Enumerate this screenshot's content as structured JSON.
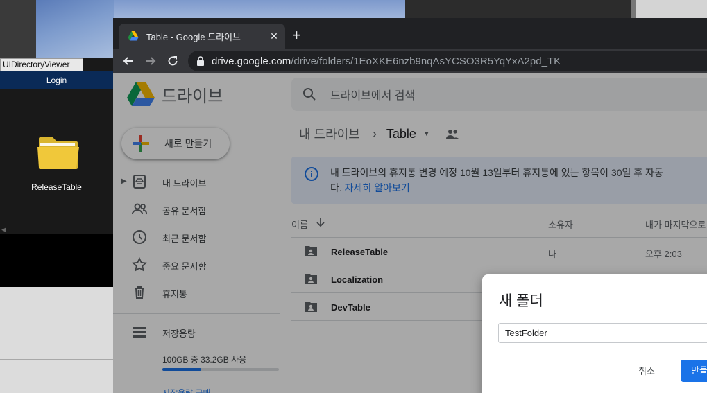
{
  "desktop_app": {
    "title": "UIDirectoryViewer",
    "login_label": "Login",
    "folder_label": "ReleaseTable"
  },
  "browser": {
    "tab_title": "Table - Google 드라이브",
    "url_host": "drive.google.com",
    "url_path": "/drive/folders/1EoXKE6nzb9nqAsYCSO3R5YqYxA2pd_TK"
  },
  "drive": {
    "brand": "드라이브",
    "search_placeholder": "드라이브에서 검색",
    "new_button": "새로 만들기",
    "sidebar": [
      {
        "label": "내 드라이브",
        "icon": "my-drive-icon"
      },
      {
        "label": "공유 문서함",
        "icon": "shared-icon"
      },
      {
        "label": "최근 문서함",
        "icon": "clock-icon"
      },
      {
        "label": "중요 문서함",
        "icon": "star-icon"
      },
      {
        "label": "휴지통",
        "icon": "trash-icon"
      },
      {
        "label": "저장용량",
        "icon": "storage-icon"
      }
    ],
    "storage_text": "100GB 중 33.2GB 사용",
    "storage_used_fraction": 0.332,
    "buy_storage": "저장용량 구매",
    "breadcrumb": {
      "root": "내 드라이브",
      "current": "Table"
    },
    "banner": {
      "line1": "내 드라이브의 휴지통 변경 예정 10월 13일부터 휴지통에 있는 항목이 30일 후 자동",
      "line2_prefix": "다.",
      "link": "자세히 알아보기"
    },
    "columns": {
      "name": "이름",
      "owner": "소유자",
      "modified": "내가 마지막으로"
    },
    "files": [
      {
        "name": "ReleaseTable",
        "owner": "나",
        "modified": "오후 2:03"
      },
      {
        "name": "Localization",
        "owner": "",
        "modified": ""
      },
      {
        "name": "DevTable",
        "owner": "",
        "modified": ""
      }
    ]
  },
  "dialog": {
    "title": "새 폴더",
    "input_value": "TestFolder",
    "cancel": "취소",
    "create": "만들기"
  },
  "colors": {
    "accent": "#1a73e8",
    "chrome_dark": "#35363a",
    "unity_bar": "#0a2a57"
  }
}
